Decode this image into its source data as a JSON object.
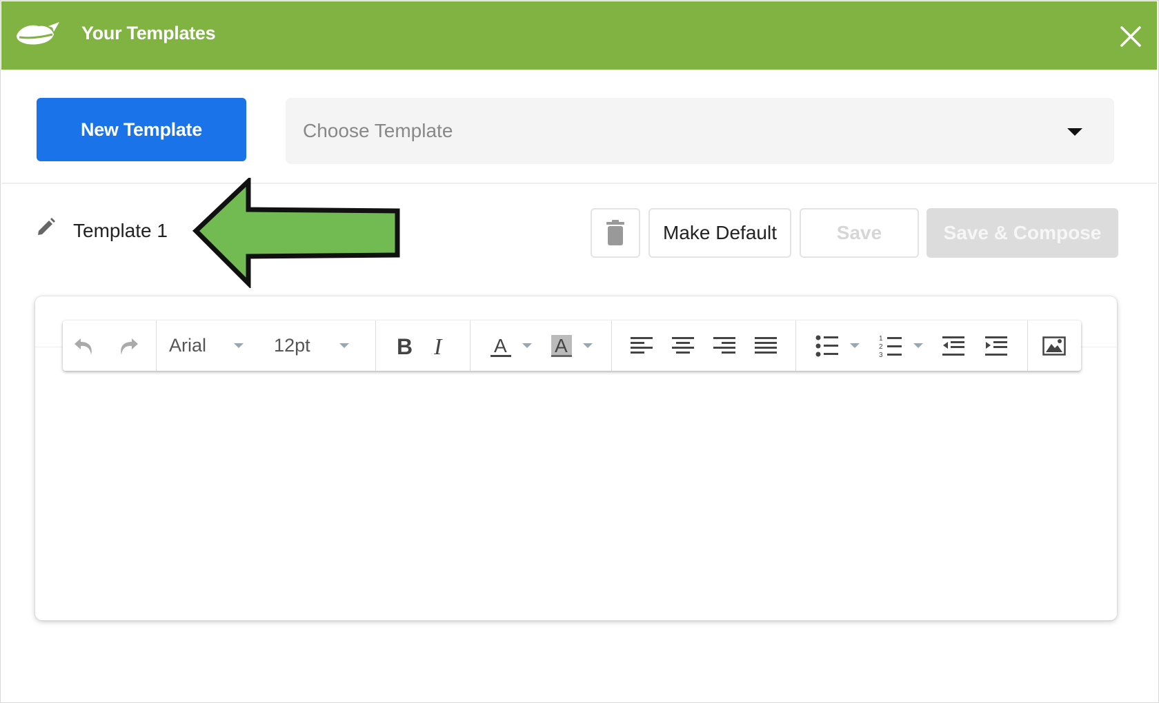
{
  "header": {
    "title": "Your Templates",
    "logo_icon": "lips-paper-plane-logo",
    "close_icon": "close-icon",
    "color": "#80b341"
  },
  "actions": {
    "new_template_label": "New Template",
    "new_template_color": "#1a73e8",
    "choose_template_placeholder": "Choose Template"
  },
  "template": {
    "name": "Template 1",
    "edit_icon": "pencil-icon"
  },
  "annotation": {
    "type": "arrow-left",
    "color": "#72bb53"
  },
  "template_actions": {
    "delete_icon": "trash-icon",
    "make_default_label": "Make Default",
    "save_label": "Save",
    "save_compose_label": "Save & Compose"
  },
  "editor": {
    "toolbar": {
      "font_family": "Arial",
      "font_size": "12pt",
      "buttons": [
        "undo",
        "redo",
        "bold",
        "italic",
        "text-color",
        "background-color",
        "align-left",
        "align-center",
        "align-right",
        "align-justify",
        "bullet-list",
        "numbered-list",
        "outdent",
        "indent",
        "insert-image"
      ]
    },
    "content": ""
  }
}
